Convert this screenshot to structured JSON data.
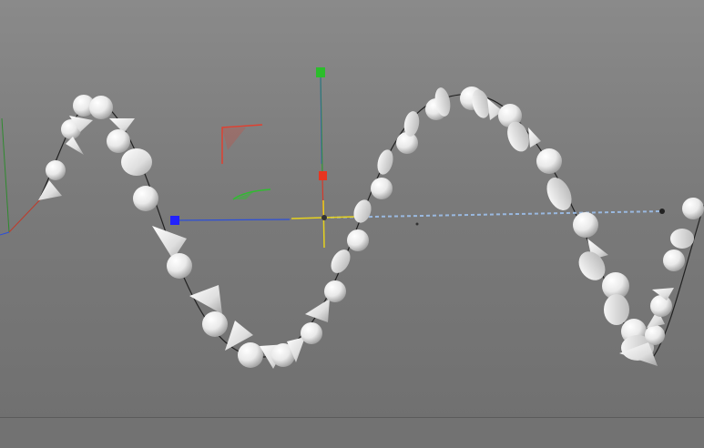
{
  "viewport": {
    "label": "",
    "background_top": "#8a8a8a",
    "background_bottom": "#6f6f6f"
  },
  "scene": {
    "object_color": "#eeeeee",
    "spline_color": "#222222",
    "axis_x_color": "#2d4fd8",
    "axis_y_color": "#2fa02f",
    "axis_z_color": "#d43a2a",
    "axis_center_color": "#e6d21e",
    "dashed_line_color": "#9ab9e0",
    "object_shapes": [
      "sphere",
      "cone",
      "disc"
    ]
  }
}
